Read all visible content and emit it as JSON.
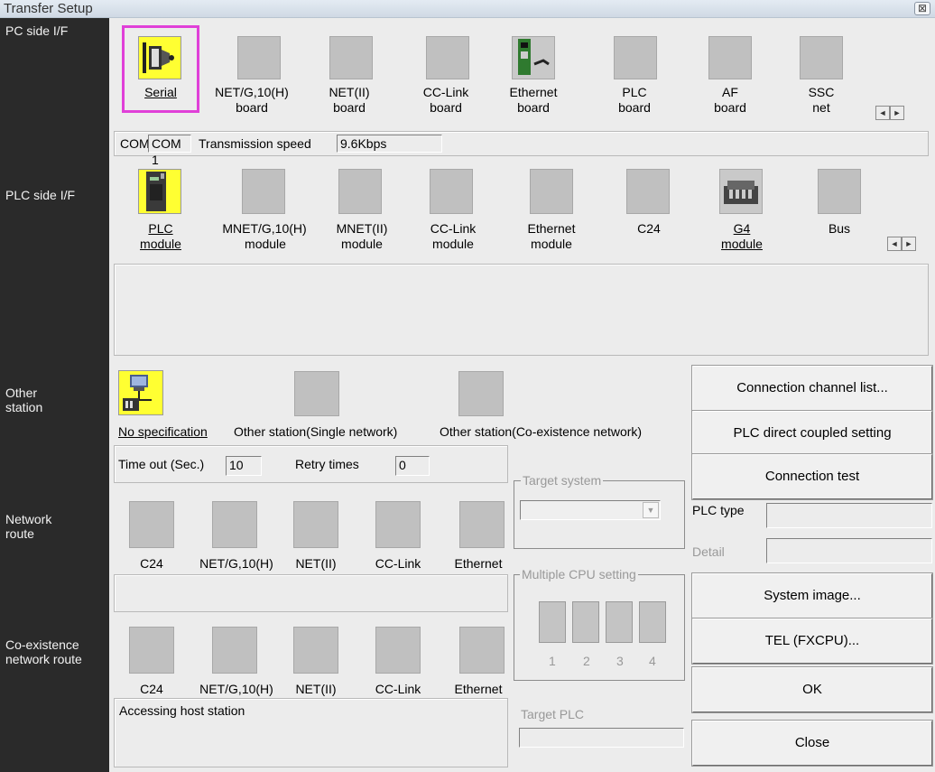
{
  "window": {
    "title": "Transfer Setup",
    "close_glyph": "⊠"
  },
  "sidebar": {
    "pc_side": "PC side I/F",
    "plc_side": "PLC side I/F",
    "other_station": [
      "Other",
      "station"
    ],
    "network_route": [
      "Network",
      "route"
    ],
    "coexistence_route": [
      "Co-existence",
      "network route"
    ]
  },
  "pc_side_if": {
    "items": [
      {
        "l1": "Serial",
        "l2": ""
      },
      {
        "l1": "NET/G,10(H)",
        "l2": "board"
      },
      {
        "l1": "NET(II)",
        "l2": "board"
      },
      {
        "l1": "CC-Link",
        "l2": "board"
      },
      {
        "l1": "Ethernet",
        "l2": "board"
      },
      {
        "l1": "PLC",
        "l2": "board"
      },
      {
        "l1": "AF",
        "l2": "board"
      },
      {
        "l1": "SSC",
        "l2": "net"
      }
    ],
    "com_label": "COM",
    "com_value": "COM 1",
    "speed_label": "Transmission speed",
    "speed_value": "9.6Kbps"
  },
  "plc_side_if": {
    "items": [
      {
        "l1": "PLC",
        "l2": "module"
      },
      {
        "l1": "MNET/G,10(H)",
        "l2": "module"
      },
      {
        "l1": "MNET(II)",
        "l2": "module"
      },
      {
        "l1": "CC-Link",
        "l2": "module"
      },
      {
        "l1": "Ethernet",
        "l2": "module"
      },
      {
        "l1": "C24",
        "l2": ""
      },
      {
        "l1": "G4",
        "l2": "module"
      },
      {
        "l1": "Bus",
        "l2": ""
      }
    ]
  },
  "other_station": {
    "items": [
      "No specification",
      "Other station(Single network)",
      "Other station(Co-existence network)"
    ],
    "timeout_label": "Time out (Sec.)",
    "timeout_value": "10",
    "retry_label": "Retry times",
    "retry_value": "0"
  },
  "network_route": {
    "items": [
      "C24",
      "NET/G,10(H)",
      "NET(II)",
      "CC-Link",
      "Ethernet"
    ]
  },
  "coexistence_route": {
    "items": [
      "C24",
      "NET/G,10(H)",
      "NET(II)",
      "CC-Link",
      "Ethernet"
    ],
    "status": "Accessing host station"
  },
  "target_system": {
    "legend": "Target system"
  },
  "multiple_cpu": {
    "legend": "Multiple CPU setting",
    "numbers": [
      "1",
      "2",
      "3",
      "4"
    ]
  },
  "target_plc": {
    "label": "Target PLC"
  },
  "right_panel": {
    "buttons": {
      "connection_channel": "Connection  channel  list...",
      "plc_direct": "PLC direct coupled setting",
      "connection_test": "Connection test",
      "system_image": "System   image...",
      "tel": "TEL (FXCPU)...",
      "ok": "OK",
      "close": "Close"
    },
    "plc_type_label": "PLC type",
    "detail_label": "Detail"
  },
  "colors": {
    "selected_icon": "#ffff32",
    "highlight_frame": "#e040d8",
    "sidebar": "#2a2a2a"
  }
}
